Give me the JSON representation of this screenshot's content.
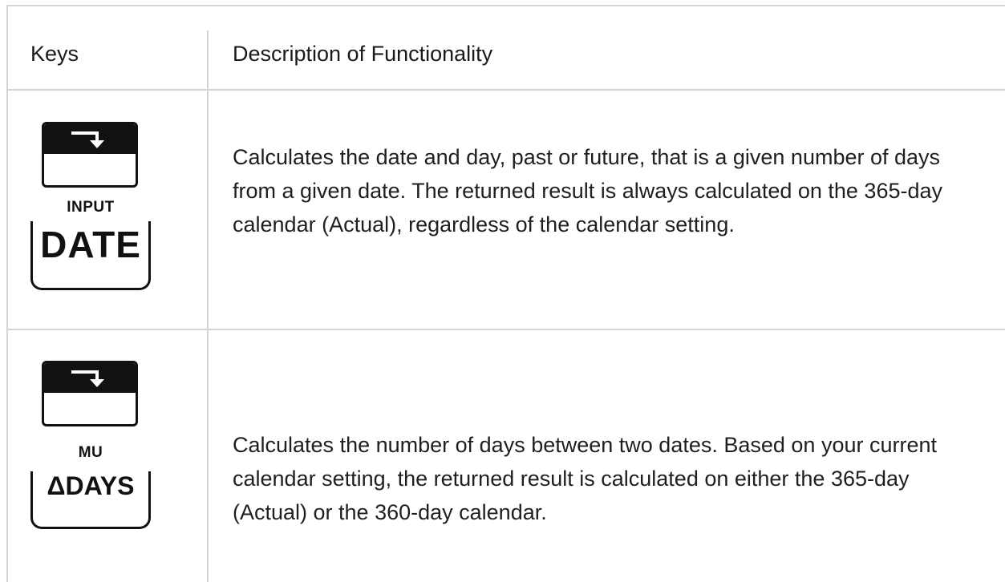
{
  "table": {
    "headers": {
      "keys": "Keys",
      "description": "Description of Functionality"
    },
    "rows": [
      {
        "key": {
          "shift_label": "INPUT",
          "main_label": "DATE",
          "shift_icon": "arrow-down-right-icon"
        },
        "description": "Calculates the date and day, past or future, that is a given number of days from a given date. The returned result is always calculated on the 365-day calendar (Actual), regardless of the calendar setting."
      },
      {
        "key": {
          "shift_label": "MU",
          "main_label": "ΔDAYS",
          "shift_icon": "arrow-down-right-icon"
        },
        "description": "Calculates the number of days between two dates. Based on your current calendar setting, the returned result is calculated on either the 365-day (Actual) or the 360-day calendar."
      }
    ]
  }
}
